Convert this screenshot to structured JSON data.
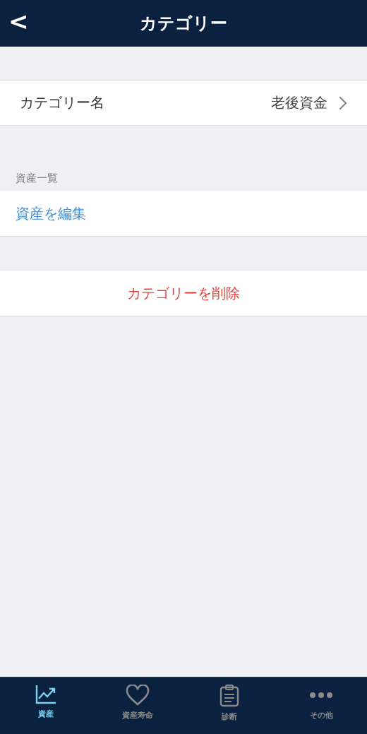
{
  "nav_bar": {
    "back": "<",
    "title": "カテゴリー"
  },
  "name_row": {
    "label": "カテゴリー名",
    "value": "老後資金"
  },
  "assets_section": {
    "header": "資産一覧",
    "action": "資産を編集"
  },
  "delete_button": "カテゴリーを削除",
  "tab_bar": [
    {
      "label": "資産",
      "kind": "chart",
      "selected": true
    },
    {
      "label": "資産寿命",
      "kind": "heart",
      "selected": false
    },
    {
      "label": "診断",
      "kind": "clipboard",
      "selected": false
    },
    {
      "label": "その他",
      "kind": "more",
      "selected": false
    }
  ]
}
